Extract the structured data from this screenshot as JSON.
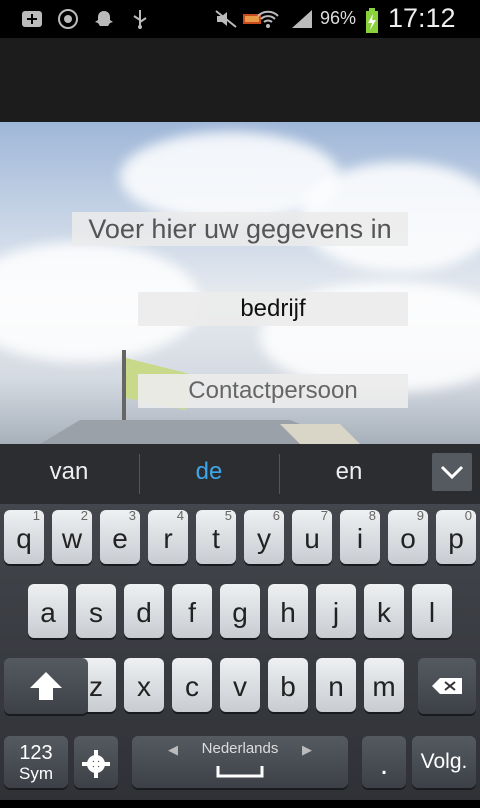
{
  "status_bar": {
    "battery_percent": "96%",
    "time": "17:12",
    "icons": [
      "add-icon",
      "whatsapp-icon",
      "snapchat-icon",
      "usb-icon",
      "mute-icon",
      "sync-icon",
      "wifi-icon",
      "signal-icon",
      "battery-charging-icon"
    ]
  },
  "form": {
    "heading": "Voer hier uw gegevens in",
    "company_value": "bedrijf",
    "contact_placeholder": "Contactpersoon"
  },
  "suggestions": [
    "van",
    "de",
    "en"
  ],
  "keyboard": {
    "row1": [
      [
        "q",
        "1"
      ],
      [
        "w",
        "2"
      ],
      [
        "e",
        "3"
      ],
      [
        "r",
        "4"
      ],
      [
        "t",
        "5"
      ],
      [
        "y",
        "6"
      ],
      [
        "u",
        "7"
      ],
      [
        "i",
        "8"
      ],
      [
        "o",
        "9"
      ],
      [
        "p",
        "0"
      ]
    ],
    "row2": [
      "a",
      "s",
      "d",
      "f",
      "g",
      "h",
      "j",
      "k",
      "l"
    ],
    "row3": [
      "z",
      "x",
      "c",
      "v",
      "b",
      "n",
      "m"
    ],
    "sym_label_1": "123",
    "sym_label_2": "Sym",
    "language": "Nederlands",
    "period": ".",
    "next": "Volg."
  },
  "colors": {
    "suggestion_highlight": "#3ea6e8"
  }
}
